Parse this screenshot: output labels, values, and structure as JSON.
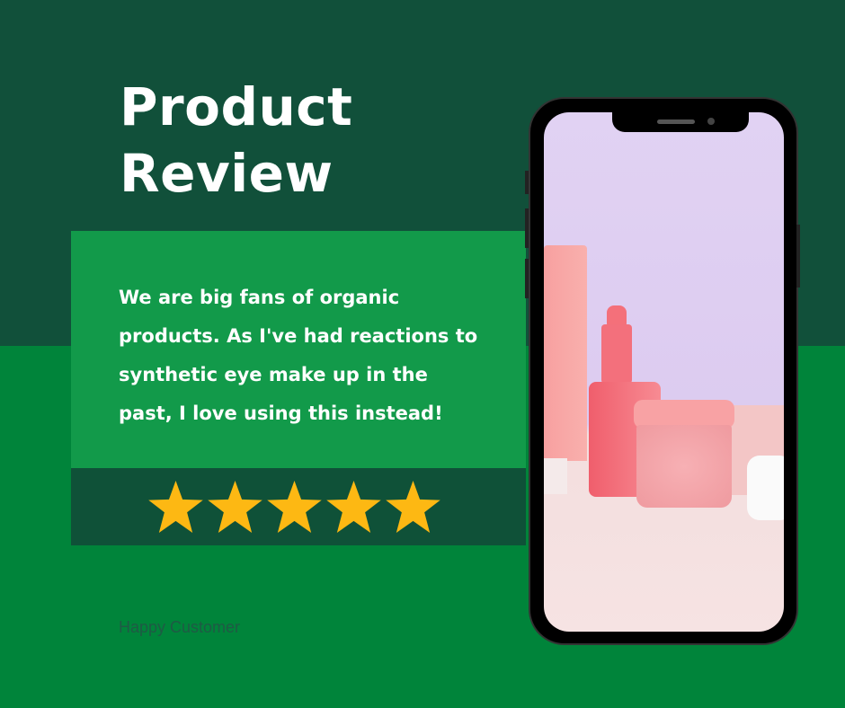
{
  "title_line1": "Product",
  "title_line2": "Review",
  "quote": "We are big fans of organic products. As I've had reactions to synthetic eye make up in the past, I love using this instead!",
  "rating": {
    "value": 5,
    "max": 5,
    "color": "#fdb813"
  },
  "customer": "Happy Customer",
  "colors": {
    "dark_green": "#11503a",
    "green": "#00843a",
    "box_green": "#129a4a"
  }
}
